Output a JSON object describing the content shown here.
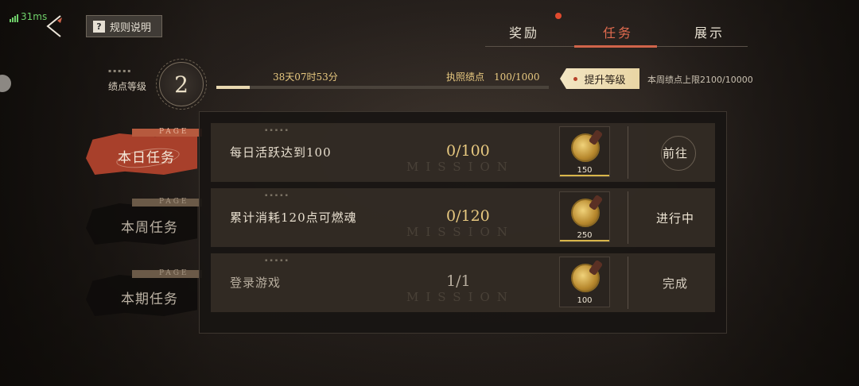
{
  "status": {
    "ping": "31ms"
  },
  "header": {
    "rules_label": "规则说明",
    "rules_icon": "?"
  },
  "tabs": [
    {
      "label": "奖励",
      "has_dot": true
    },
    {
      "label": "任务",
      "active": true
    },
    {
      "label": "展示"
    }
  ],
  "level": {
    "label": "绩点等级",
    "value": "2",
    "timer": "38天07时53分",
    "license": "执照绩点　100/1000",
    "progress": 0.1,
    "upgrade_label": "提升等级",
    "week_limit": "本周绩点上限2100/10000"
  },
  "sidebar": {
    "page_tag": "PAGE",
    "items": [
      {
        "label": "本日任务",
        "active": true
      },
      {
        "label": "本周任务"
      },
      {
        "label": "本期任务"
      }
    ]
  },
  "tasks": [
    {
      "name": "每日活跃达到100",
      "progress": "0/100",
      "watermark": "MISSION",
      "reward": "150",
      "action": "前往",
      "state": "go"
    },
    {
      "name": "累计消耗120点可燃魂",
      "progress": "0/120",
      "watermark": "MISSION",
      "reward": "250",
      "action": "进行中",
      "state": "in-progress"
    },
    {
      "name": "登录游戏",
      "progress": "1/1",
      "watermark": "MISSION",
      "reward": "100",
      "action": "完成",
      "state": "done"
    }
  ],
  "colors": {
    "accent": "#d0644a",
    "gold": "#e8c980"
  }
}
